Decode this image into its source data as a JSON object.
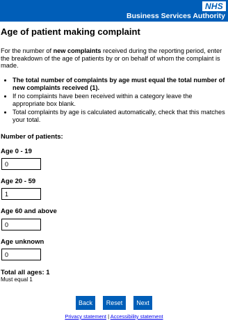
{
  "header": {
    "logo_text": "NHS",
    "org_name": "Business Services Authority",
    "brand_color": "#005eb8"
  },
  "page": {
    "title": "Age of patient making complaint",
    "intro_before": "For the number of ",
    "intro_bold": "new complaints",
    "intro_after": " received during the reporting period, enter the breakdown of  the age of patients by or on behalf of whom the complaint is made.",
    "bullets": [
      "The total number of complaints by age must equal the total number of new complaints received (1).",
      "If no complaints have been received within a category leave the appropriate box blank.",
      "Total complaints by age is calculated automatically, check that this matches your total."
    ]
  },
  "form": {
    "section_label": "Number of patients:",
    "fields": [
      {
        "label": "Age 0 - 19",
        "value": "0"
      },
      {
        "label": "Age 20 - 59",
        "value": "1"
      },
      {
        "label": "Age 60 and above",
        "value": "0"
      },
      {
        "label": "Age unknown",
        "value": "0"
      }
    ],
    "total_label": "Total all ages: 1",
    "must_equal": "Must equal 1"
  },
  "buttons": {
    "back": "Back",
    "reset": "Reset",
    "next": "Next"
  },
  "footer": {
    "privacy": "Privacy statement",
    "separator": "|",
    "accessibility": "Accessibility statement"
  }
}
